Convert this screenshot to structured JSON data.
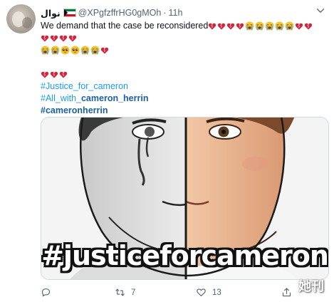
{
  "tweet": {
    "author": {
      "display_name": "نوال",
      "flag_icon": "kuwait-flag-icon",
      "handle": "@XPgfzffrHG0gMOh",
      "separator": "·",
      "time": "11h"
    },
    "lines": {
      "l1_text": "We demand that the case be reconsidered",
      "hashtag1": "#Justice_for_cameron",
      "hashtag2_prefix": "#All_with_",
      "hashtag2_bold": "cameron_herrin",
      "hashtag3": "#cameronherrin"
    },
    "emoji": {
      "broken_heart": "broken-heart-icon",
      "sob": "loudly-crying-face-icon",
      "pleading": "pleading-face-icon",
      "colors": {
        "heart": "#d6223a",
        "face": "#f7c12b",
        "tear": "#5aa6e8"
      }
    },
    "media": {
      "overlay_text": "#justiceforcameron",
      "watermark": "她刊"
    },
    "actions": {
      "reply_count": "",
      "retweet_count": "7",
      "like_count": "13"
    }
  },
  "colors": {
    "accent": "#1d9bf0",
    "muted": "#536471",
    "text": "#0f1419"
  }
}
